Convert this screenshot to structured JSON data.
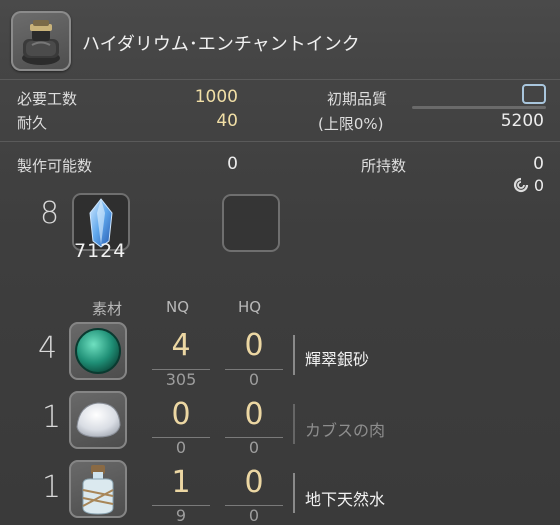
{
  "item": {
    "name": "ハイダリウム･エンチャントインク",
    "icon": "ink-bottle-icon"
  },
  "stats": {
    "required_craftsmanship_label": "必要工数",
    "required_craftsmanship_value": "1000",
    "durability_label": "耐久",
    "durability_value": "40",
    "initial_quality_label": "初期品質",
    "max_quality_label": "(上限0%)",
    "max_quality_value": "5200",
    "initial_quality_level": 0
  },
  "counts": {
    "craftable_label": "製作可能数",
    "craftable_value": "0",
    "owned_label": "所持数",
    "owned_value": "0",
    "collectable_value": "0",
    "collectable_icon": "collectable-icon"
  },
  "crystals": {
    "required_amount": "8",
    "owned_amount": "7124",
    "icon": "water-crystal-icon",
    "empty_slot_icon": "empty-slot-icon"
  },
  "materials_header": {
    "material_label": "素材",
    "nq_label": "NQ",
    "hq_label": "HQ"
  },
  "materials": [
    {
      "required": "4",
      "nq": "4",
      "hq": "0",
      "nq_owned": "305",
      "hq_owned": "0",
      "name": "輝翠銀砂",
      "available": true,
      "icon": "green-sand-icon"
    },
    {
      "required": "1",
      "nq": "0",
      "hq": "0",
      "nq_owned": "0",
      "hq_owned": "0",
      "name": "カブスの肉",
      "available": false,
      "icon": "meat-icon"
    },
    {
      "required": "1",
      "nq": "1",
      "hq": "0",
      "nq_owned": "9",
      "hq_owned": "0",
      "name": "地下天然水",
      "available": true,
      "icon": "water-bottle-icon"
    }
  ],
  "colors": {
    "gold_value": "#f1dfa6",
    "unavailable_text": "#8e8e8e",
    "available_text": "#f2f2f2",
    "quality_box": "#a9c6dd"
  }
}
